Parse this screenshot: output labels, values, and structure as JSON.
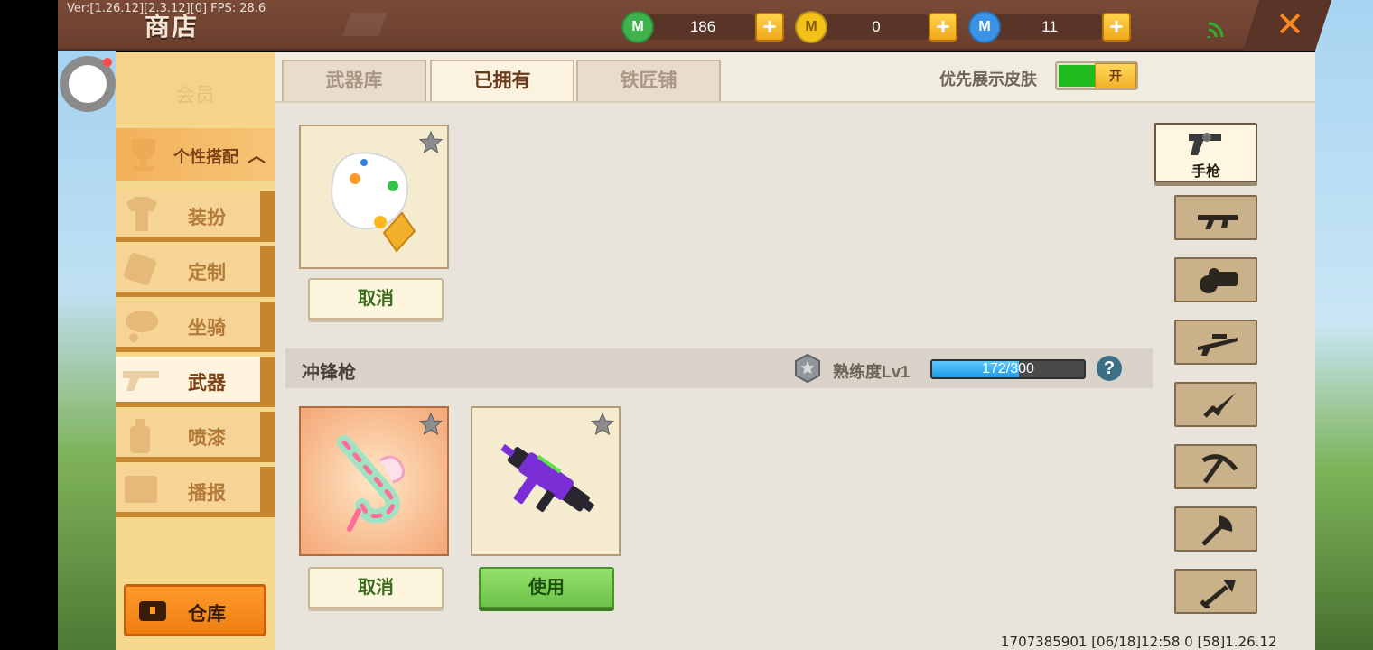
{
  "app": {
    "version_text": "Ver:[1.26.12][2.3.12][0] FPS: 28.6",
    "title": "商店"
  },
  "currencies": [
    {
      "name": "green-gem-icon",
      "value": "186",
      "color": "#3fb24d",
      "glyph": "M"
    },
    {
      "name": "gold-coin-icon",
      "value": "0",
      "color": "#f2c21b",
      "glyph": "M"
    },
    {
      "name": "blue-coin-icon",
      "value": "11",
      "color": "#3a93e6",
      "glyph": "M"
    }
  ],
  "left_menu": {
    "partial_label": "会员",
    "header_label": "个性搭配",
    "items": [
      {
        "label": "装扮",
        "icon": "shirt-icon"
      },
      {
        "label": "定制",
        "icon": "brush-icon"
      },
      {
        "label": "坐骑",
        "icon": "mount-icon"
      },
      {
        "label": "武器",
        "icon": "gun-icon",
        "active": true
      },
      {
        "label": "喷漆",
        "icon": "spray-icon"
      },
      {
        "label": "播报",
        "icon": "broadcast-icon"
      }
    ],
    "warehouse_label": "仓库"
  },
  "tabs": [
    {
      "label": "武器库"
    },
    {
      "label": "已拥有",
      "active": true
    },
    {
      "label": "铁匠铺"
    }
  ],
  "skin_toggle": {
    "label": "优先展示皮肤",
    "state": "开"
  },
  "first_section": {
    "button_label": "取消"
  },
  "smg_section": {
    "title": "冲锋枪",
    "proficiency_label": "熟练度Lv1",
    "progress_text": "172/300",
    "progress_current": 172,
    "progress_max": 300,
    "help_glyph": "?",
    "items": [
      {
        "button_label": "取消",
        "selected": true
      },
      {
        "button_label": "使用",
        "selected": false
      }
    ]
  },
  "filters": [
    {
      "label": "手枪",
      "icon": "pistol-icon",
      "active": true
    },
    {
      "label": "",
      "icon": "assault-rifle-icon"
    },
    {
      "label": "",
      "icon": "minigun-icon"
    },
    {
      "label": "",
      "icon": "sniper-rifle-icon"
    },
    {
      "label": "",
      "icon": "dagger-icon"
    },
    {
      "label": "",
      "icon": "pickaxe-icon"
    },
    {
      "label": "",
      "icon": "axe-icon"
    },
    {
      "label": "",
      "icon": "shovel-icon"
    }
  ],
  "footer": {
    "info": "1707385901   [06/18]12:58 0   [58]1.26.12"
  },
  "colors": {
    "topbar": "#6a3e2e",
    "accent_orange": "#f07e12",
    "progress_fill": "#1e9be8",
    "use_green": "#6cc24a"
  }
}
